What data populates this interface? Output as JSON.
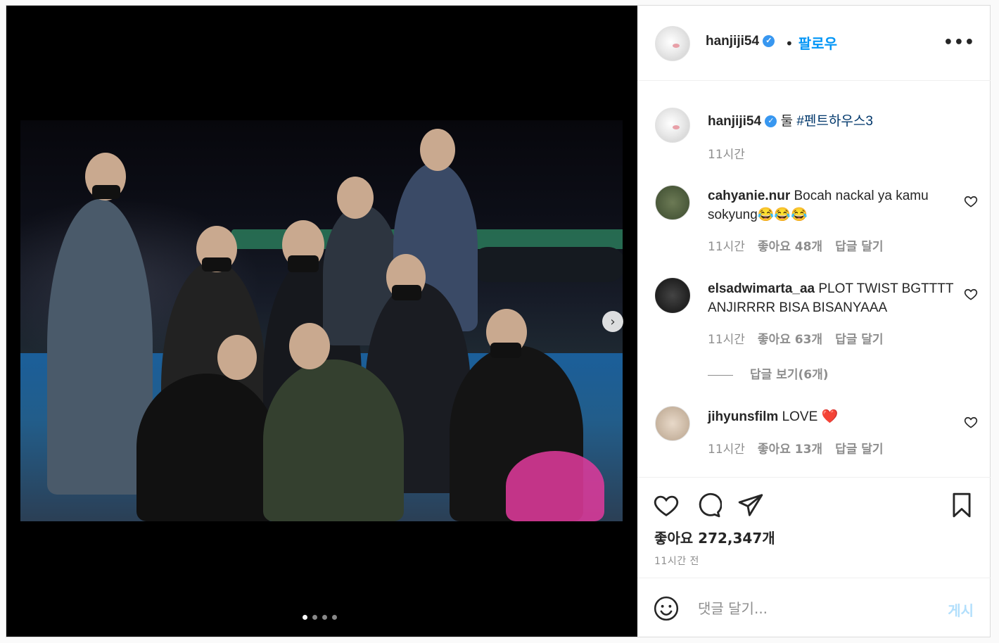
{
  "post": {
    "author": "hanjiji54",
    "follow_label": "팔로우",
    "separator": "•",
    "more_label": "•••",
    "caption": {
      "username": "hanjiji54",
      "text_prefix": "둘 ",
      "hashtag": "#펜트하우스3",
      "time": "11시간"
    },
    "comments": [
      {
        "username": "cahyanie.nur",
        "text": "Bocah nackal ya kamu sokyung😂😂😂",
        "time": "11시간",
        "likes": "좋아요 48개",
        "reply": "답글 달기"
      },
      {
        "username": "elsadwimarta_aa",
        "text": "PLOT TWIST BGTTTT ANJIRRRR BISA BISANYAAA",
        "time": "11시간",
        "likes": "좋아요 63개",
        "reply": "답글 달기"
      },
      {
        "username": "jihyunsfilm",
        "text": "LOVE ❤️",
        "time": "11시간",
        "likes": "좋아요 13개",
        "reply": "답글 달기"
      }
    ],
    "view_replies": "답글 보기(6개)",
    "likes_total": "좋아요 272,347개",
    "posted_ago": "11시간 전",
    "comment_placeholder": "댓글 달기...",
    "post_button": "게시",
    "carousel": {
      "total_slides": 4,
      "current_slide": 1
    }
  }
}
